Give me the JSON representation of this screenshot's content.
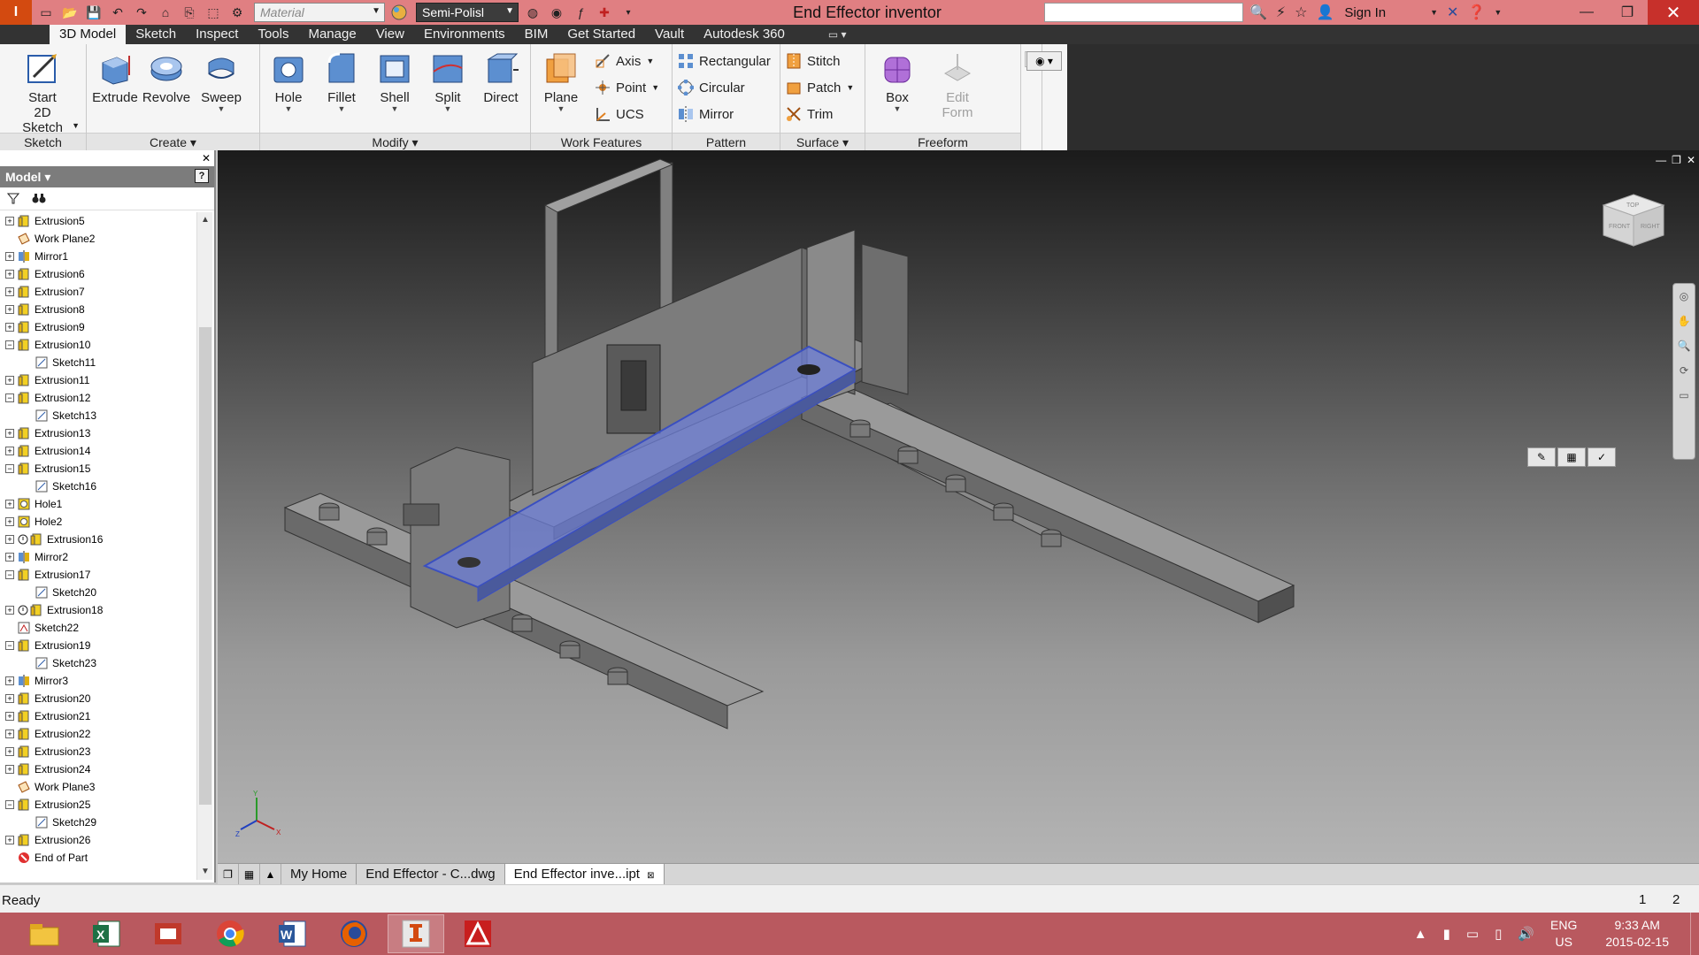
{
  "titlebar": {
    "app_letter": "I",
    "material_placeholder": "Material",
    "appearance_value": "Semi-Polisl",
    "title": "End Effector inventor",
    "sign_in": "Sign In"
  },
  "tabs": [
    {
      "label": "3D Model",
      "active": true
    },
    {
      "label": "Sketch"
    },
    {
      "label": "Inspect"
    },
    {
      "label": "Tools"
    },
    {
      "label": "Manage"
    },
    {
      "label": "View"
    },
    {
      "label": "Environments"
    },
    {
      "label": "BIM"
    },
    {
      "label": "Get Started"
    },
    {
      "label": "Vault"
    },
    {
      "label": "Autodesk 360"
    }
  ],
  "ribbon": {
    "sketch": {
      "title": "Sketch",
      "start_line1": "Start",
      "start_line2": "2D Sketch"
    },
    "create": {
      "title": "Create",
      "extrude": "Extrude",
      "revolve": "Revolve",
      "sweep": "Sweep"
    },
    "modify": {
      "title": "Modify",
      "hole": "Hole",
      "fillet": "Fillet",
      "shell": "Shell",
      "split": "Split",
      "direct": "Direct"
    },
    "work_features": {
      "title": "Work Features",
      "plane": "Plane",
      "axis": "Axis",
      "point": "Point",
      "ucs": "UCS"
    },
    "pattern": {
      "title": "Pattern",
      "rectangular": "Rectangular",
      "circular": "Circular",
      "mirror": "Mirror"
    },
    "surface": {
      "title": "Surface",
      "stitch": "Stitch",
      "patch": "Patch",
      "trim": "Trim"
    },
    "freeform": {
      "title": "Freeform",
      "box": "Box",
      "edit_line1": "Edit",
      "edit_line2": "Form"
    }
  },
  "browser": {
    "header": "Model",
    "help": "?",
    "tree": [
      {
        "label": "Extrusion5",
        "type": "extrusion",
        "expand": "+"
      },
      {
        "label": "Work Plane2",
        "type": "plane",
        "expand": ""
      },
      {
        "label": "Mirror1",
        "type": "mirror",
        "expand": "+"
      },
      {
        "label": "Extrusion6",
        "type": "extrusion",
        "expand": "+"
      },
      {
        "label": "Extrusion7",
        "type": "extrusion",
        "expand": "+"
      },
      {
        "label": "Extrusion8",
        "type": "extrusion",
        "expand": "+"
      },
      {
        "label": "Extrusion9",
        "type": "extrusion",
        "expand": "+"
      },
      {
        "label": "Extrusion10",
        "type": "extrusion",
        "expand": "−"
      },
      {
        "label": "Sketch11",
        "type": "sketch",
        "child": true
      },
      {
        "label": "Extrusion11",
        "type": "extrusion",
        "expand": "+"
      },
      {
        "label": "Extrusion12",
        "type": "extrusion",
        "expand": "−"
      },
      {
        "label": "Sketch13",
        "type": "sketch",
        "child": true
      },
      {
        "label": "Extrusion13",
        "type": "extrusion",
        "expand": "+"
      },
      {
        "label": "Extrusion14",
        "type": "extrusion",
        "expand": "+"
      },
      {
        "label": "Extrusion15",
        "type": "extrusion",
        "expand": "−"
      },
      {
        "label": "Sketch16",
        "type": "sketch",
        "child": true
      },
      {
        "label": "Hole1",
        "type": "hole",
        "expand": "+"
      },
      {
        "label": "Hole2",
        "type": "hole",
        "expand": "+"
      },
      {
        "label": "Extrusion16",
        "type": "extrusion-warn",
        "expand": "+"
      },
      {
        "label": "Mirror2",
        "type": "mirror",
        "expand": "+"
      },
      {
        "label": "Extrusion17",
        "type": "extrusion",
        "expand": "−"
      },
      {
        "label": "Sketch20",
        "type": "sketch",
        "child": true
      },
      {
        "label": "Extrusion18",
        "type": "extrusion-warn",
        "expand": "+"
      },
      {
        "label": "Sketch22",
        "type": "sketch3d",
        "expand": ""
      },
      {
        "label": "Extrusion19",
        "type": "extrusion",
        "expand": "−"
      },
      {
        "label": "Sketch23",
        "type": "sketch",
        "child": true
      },
      {
        "label": "Mirror3",
        "type": "mirror",
        "expand": "+"
      },
      {
        "label": "Extrusion20",
        "type": "extrusion",
        "expand": "+"
      },
      {
        "label": "Extrusion21",
        "type": "extrusion",
        "expand": "+"
      },
      {
        "label": "Extrusion22",
        "type": "extrusion",
        "expand": "+"
      },
      {
        "label": "Extrusion23",
        "type": "extrusion",
        "expand": "+"
      },
      {
        "label": "Extrusion24",
        "type": "extrusion",
        "expand": "+"
      },
      {
        "label": "Work Plane3",
        "type": "plane",
        "expand": ""
      },
      {
        "label": "Extrusion25",
        "type": "extrusion",
        "expand": "−"
      },
      {
        "label": "Sketch29",
        "type": "sketch",
        "child": true
      },
      {
        "label": "Extrusion26",
        "type": "extrusion",
        "expand": "+"
      },
      {
        "label": "End of Part",
        "type": "endpart",
        "expand": ""
      }
    ]
  },
  "viewcube": {
    "top": "TOP",
    "front": "FRONT",
    "right": "RIGHT"
  },
  "triad": {
    "x": "X",
    "y": "Y",
    "z": "Z"
  },
  "doctabs": [
    {
      "label": "My Home",
      "active": false
    },
    {
      "label": "End Effector - C...dwg",
      "active": false
    },
    {
      "label": "End Effector inve...ipt",
      "active": true
    }
  ],
  "status": {
    "text": "Ready",
    "num1": "1",
    "num2": "2"
  },
  "taskbar": {
    "apps": [
      "file-explorer-icon",
      "excel-icon",
      "reader-icon",
      "chrome-icon",
      "word-icon",
      "firefox-icon",
      "inventor-icon",
      "autocad-icon"
    ],
    "lang_line1": "ENG",
    "lang_line2": "US",
    "time": "9:33 AM",
    "date": "2015-02-15"
  },
  "colors": {
    "titlebar": "#e07f82",
    "taskbar": "#b9595f",
    "selection": "#6d7fd8",
    "tab_bar": "#333333"
  }
}
